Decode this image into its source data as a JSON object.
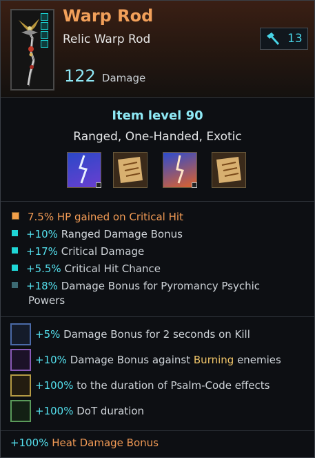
{
  "item": {
    "name": "Warp Rod",
    "subtitle": "Relic Warp Rod",
    "item_level_badge": "13",
    "damage_value": "122",
    "damage_label": "Damage",
    "item_level_text": "Item level 90",
    "tags": "Ranged, One-Handed, Exotic"
  },
  "mods": [
    {
      "name": "psychic-lightning-mod",
      "color": "#6e46d6"
    },
    {
      "name": "scroll-mod-1",
      "color": "#b07838"
    },
    {
      "name": "psychic-fire-mod",
      "color": "#e06a2a"
    },
    {
      "name": "scroll-mod-2",
      "color": "#b07838"
    }
  ],
  "traits": [
    {
      "value": "7.5%",
      "text": "HP gained on Critical Hit",
      "bullet_color": "#f2a04a",
      "value_color": "orange",
      "text_color": "orange"
    },
    {
      "value": "+10%",
      "text": "Ranged Damage Bonus",
      "bullet_color": "#1fd6d6"
    },
    {
      "value": "+17%",
      "text": "Critical Damage",
      "bullet_color": "#1fd6d6"
    },
    {
      "value": "+5.5%",
      "text": "Critical Hit Chance",
      "bullet_color": "#1fd6d6"
    },
    {
      "value": "+18%",
      "text": "Damage Bonus for Pyromancy Psychic",
      "text_line2": "Powers",
      "bullet_color": "#3c6a73"
    }
  ],
  "passives": [
    {
      "value": "+5%",
      "text": "Damage Bonus for 2 seconds on Kill",
      "border": "#4b6aa8"
    },
    {
      "value": "+10%",
      "text_pre": "Damage Bonus against ",
      "text_highlight": "Burning",
      "text_post": " enemies",
      "border": "#8a5ab8"
    },
    {
      "value": "+100%",
      "text": "to the duration of Psalm-Code effects",
      "border": "#b59a44"
    },
    {
      "value": "+100%",
      "text": "DoT duration",
      "border": "#5a9a5a"
    }
  ],
  "footer": {
    "value": "+100%",
    "text": "Heat Damage Bonus"
  },
  "colors": {
    "accent_orange": "#f2a05a",
    "accent_cyan": "#54e0ee"
  }
}
